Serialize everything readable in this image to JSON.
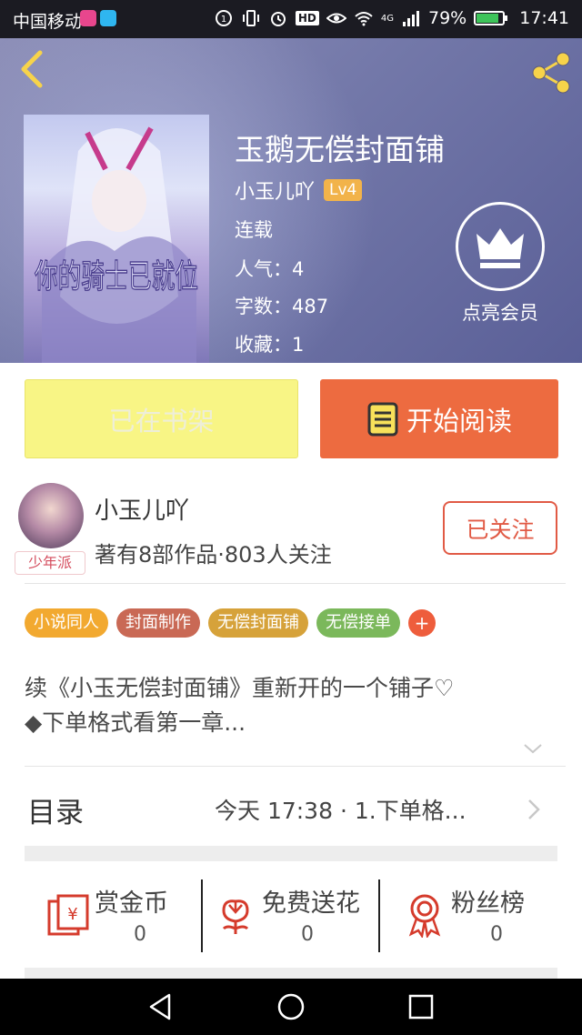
{
  "status_bar": {
    "carrier": "中国移动",
    "time": "17:41",
    "battery": "79%",
    "battery_level": 0.79,
    "network": "4G",
    "hd": "HD"
  },
  "header": {
    "book_title": "玉鹅无偿封面铺",
    "author": "小玉儿吖",
    "author_level": "Lv4",
    "status": "连载",
    "popularity": "人气：4",
    "word_count": "字数：487",
    "favorites": "收藏：1",
    "vip_label": "点亮会员",
    "cover_title": "你的骑士已就位"
  },
  "actions": {
    "shelf_label": "已在书架",
    "read_label": "开始阅读"
  },
  "author_card": {
    "name": "小玉儿吖",
    "stats": "著有8部作品·803人关注",
    "badge": "少年派",
    "follow_label": "已关注"
  },
  "tags": [
    {
      "label": "小说同人",
      "color": "#f2a930"
    },
    {
      "label": "封面制作",
      "color": "#c96955"
    },
    {
      "label": "无偿封面铺",
      "color": "#d6a23a"
    },
    {
      "label": "无偿接单",
      "color": "#7bb85b"
    }
  ],
  "tag_more": "+",
  "description": {
    "line1": "续《小玉无偿封面铺》重新开的一个铺子♡",
    "line2": "◆下单格式看第一章..."
  },
  "toc": {
    "label": "目录",
    "latest": "今天 17:38 · 1.下单格..."
  },
  "rewards": [
    {
      "label": "赏金币",
      "count": "0",
      "icon": "coin-envelope-icon"
    },
    {
      "label": "免费送花",
      "count": "0",
      "icon": "flower-icon"
    },
    {
      "label": "粉丝榜",
      "count": "0",
      "icon": "medal-icon"
    }
  ],
  "colors": {
    "accent": "#ed6b40",
    "shelf_button": "#f8f585",
    "follow": "#e15a45",
    "lv_badge": "#f2b34a"
  }
}
